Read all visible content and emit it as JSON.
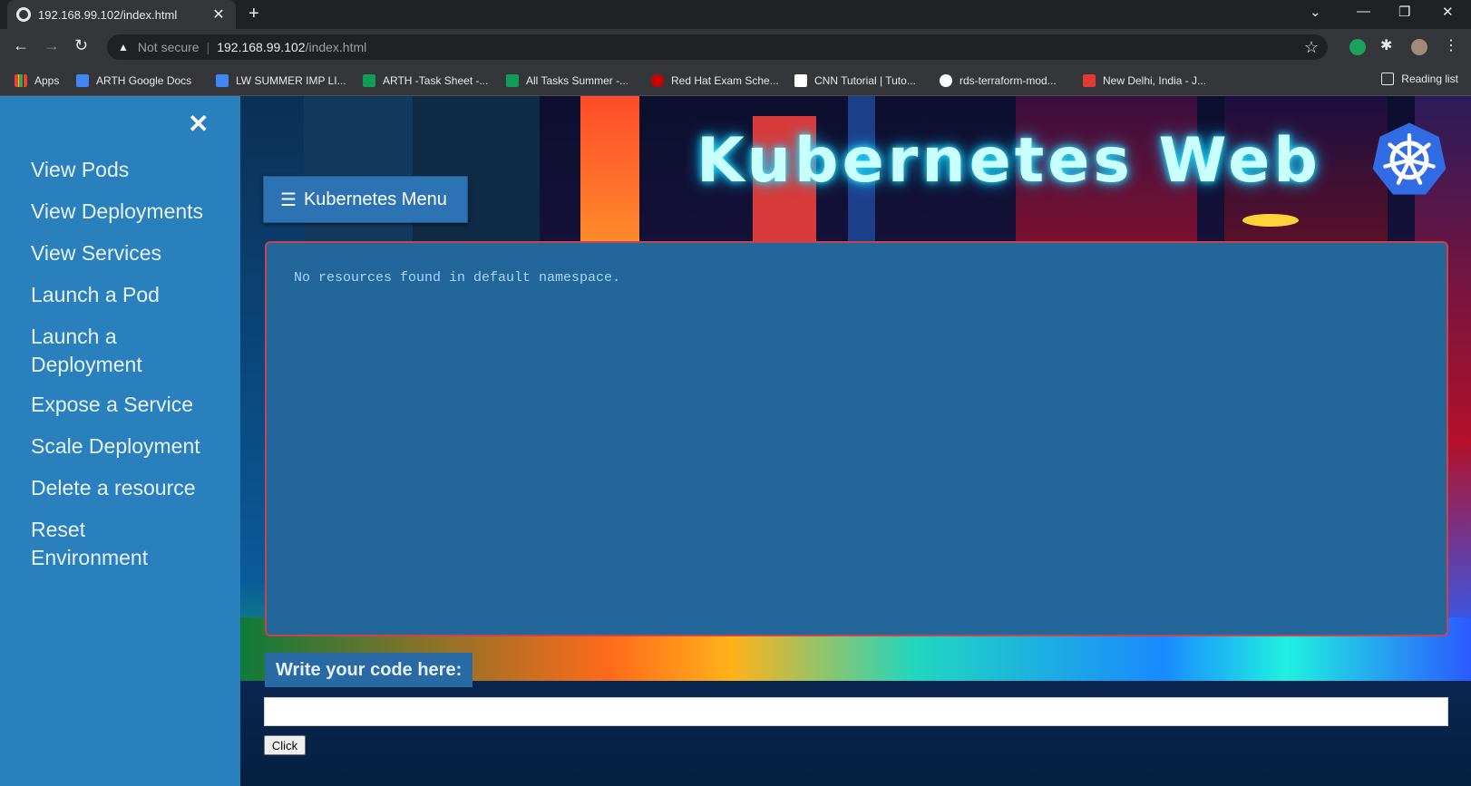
{
  "browser": {
    "tab_title": "192.168.99.102/index.html",
    "tab_close": "✕",
    "new_tab": "+",
    "security_label": "Not secure",
    "url_host": "192.168.99.102",
    "url_path": "/index.html",
    "bookmarks": [
      {
        "label": "Apps",
        "color": "#4285f4"
      },
      {
        "label": "ARTH  Google Docs",
        "color": "#4285f4"
      },
      {
        "label": "LW SUMMER IMP LI...",
        "color": "#4285f4"
      },
      {
        "label": "ARTH -Task Sheet -...",
        "color": "#0f9d58"
      },
      {
        "label": "All Tasks Summer -...",
        "color": "#0f9d58"
      },
      {
        "label": "Red Hat Exam Sche...",
        "color": "#cc0000"
      },
      {
        "label": "CNN Tutorial | Tuto...",
        "color": "#ffffff"
      },
      {
        "label": "rds-terraform-mod...",
        "color": "#ffffff"
      },
      {
        "label": "New Delhi, India - J...",
        "color": "#e53935"
      }
    ],
    "reading_list": "Reading list"
  },
  "sidebar": {
    "close": "✕",
    "items": [
      {
        "label": "View Pods"
      },
      {
        "label": "View Deployments"
      },
      {
        "label": "View Services"
      },
      {
        "label": "Launch a Pod"
      },
      {
        "label": "Launch a Deployment"
      },
      {
        "label": "Expose a Service"
      },
      {
        "label": "Scale Deployment"
      },
      {
        "label": "Delete a resource"
      },
      {
        "label": "Reset Environment"
      }
    ]
  },
  "header": {
    "title": "Kubernetes Web"
  },
  "menu_button": {
    "icon": "☰",
    "label": "Kubernetes Menu"
  },
  "output": {
    "text": "No resources found in default namespace."
  },
  "code": {
    "label": "Write your code here:",
    "value": "",
    "button": "Click"
  },
  "colors": {
    "sidebar": "#2a7fbd",
    "output_bg": "#22669a",
    "output_border": "#c6454e",
    "title_glow": "#35e6ff"
  }
}
